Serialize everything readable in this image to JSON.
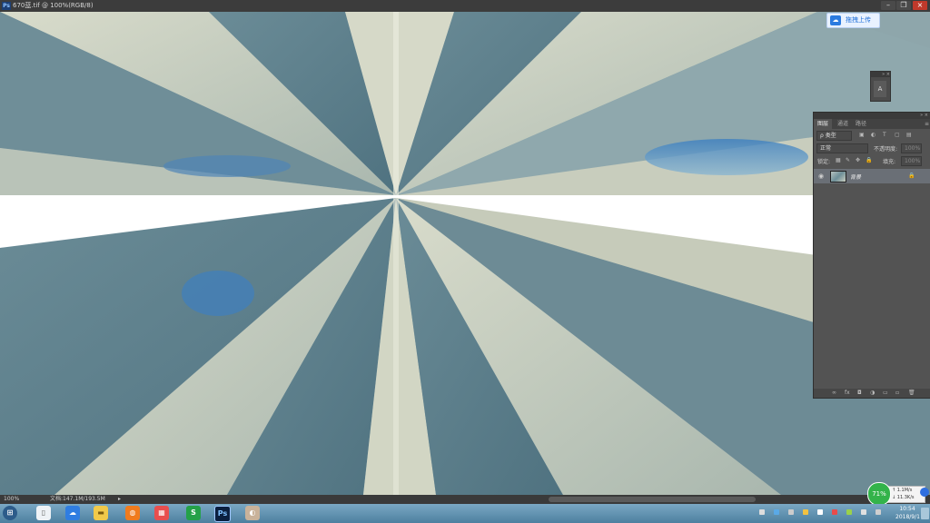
{
  "window": {
    "title": "670蓝.tif @ 100%(RGB/8)",
    "app_icon": "Ps"
  },
  "upload": {
    "label": "拖拽上传"
  },
  "layers_panel": {
    "tabs": [
      "图层",
      "通道",
      "路径"
    ],
    "filter_label": "ρ 类型",
    "blend_mode": "正常",
    "opacity_label": "不透明度:",
    "opacity_value": "100%",
    "lock_label": "锁定:",
    "fill_label": "填充:",
    "fill_value": "100%",
    "layer": {
      "name": "背景"
    }
  },
  "mini_panel": {
    "label": "A"
  },
  "status": {
    "zoom": "100%",
    "doc": "文档:147.1M/193.5M"
  },
  "network": {
    "percent": "71%",
    "up": "1.1M/s",
    "down": "11.3K/s"
  },
  "clock": {
    "time": "10:54",
    "date": "2018/9/1"
  },
  "taskbar": {
    "items": [
      "file",
      "baidu-netdisk",
      "folder",
      "browser",
      "mosaic",
      "wps",
      "photoshop",
      "image"
    ]
  },
  "colors": {
    "panel": "#535353",
    "accent": "#2b7be0",
    "taskbar": "#5f8fad"
  }
}
